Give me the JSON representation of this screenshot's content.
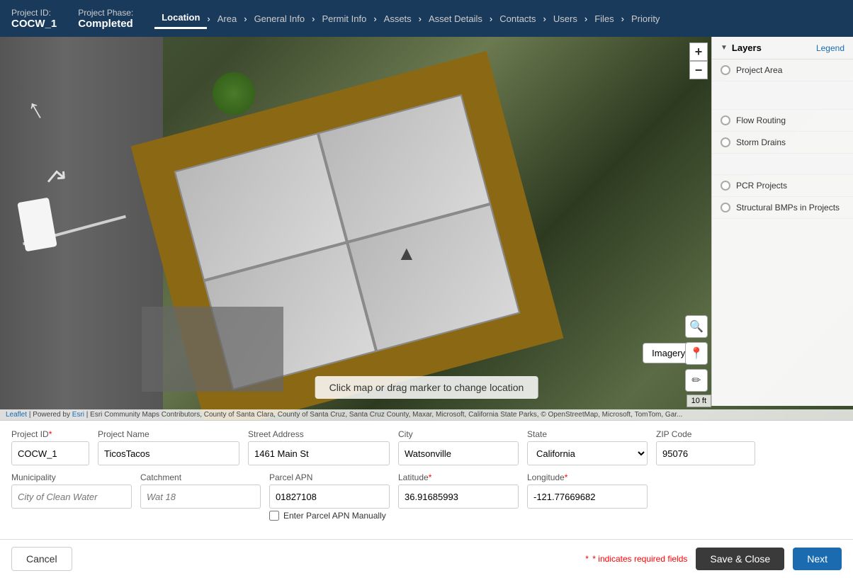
{
  "header": {
    "project_id_label": "Project ID:",
    "project_id_value": "COCW_1",
    "phase_label": "Project Phase:",
    "phase_value": "Completed"
  },
  "nav": {
    "tabs": [
      {
        "id": "location",
        "label": "Location",
        "active": true
      },
      {
        "id": "area",
        "label": "Area"
      },
      {
        "id": "general-info",
        "label": "General Info"
      },
      {
        "id": "permit-info",
        "label": "Permit Info"
      },
      {
        "id": "assets",
        "label": "Assets"
      },
      {
        "id": "asset-details",
        "label": "Asset Details"
      },
      {
        "id": "contacts",
        "label": "Contacts"
      },
      {
        "id": "users",
        "label": "Users"
      },
      {
        "id": "files",
        "label": "Files"
      },
      {
        "id": "priority",
        "label": "Priority"
      }
    ]
  },
  "layers": {
    "title": "Layers",
    "legend_link": "Legend",
    "items": [
      {
        "id": "project-area",
        "label": "Project Area"
      },
      {
        "id": "flow-routing",
        "label": "Flow Routing"
      },
      {
        "id": "storm-drains",
        "label": "Storm Drains"
      },
      {
        "id": "pcr-projects",
        "label": "PCR Projects"
      },
      {
        "id": "structural-bmps",
        "label": "Structural BMPs in Projects"
      }
    ]
  },
  "map": {
    "instruction": "Click map or drag marker to change location",
    "attribution": "Leaflet | Powered by Esri | Esri Community Maps Contributors, County of Santa Clara, County of Santa Cruz, Santa Cruz County, Maxar, Microsoft, California State Parks, © OpenStreetMap, Microsoft, TomTom, Gar...",
    "scale": "10 ft",
    "imagery_label": "Imagery"
  },
  "form": {
    "project_id_label": "Project ID",
    "project_id_value": "COCW_1",
    "project_name_label": "Project Name",
    "project_name_value": "TicosTacos",
    "street_label": "Street Address",
    "street_value": "1461 Main St",
    "city_label": "City",
    "city_value": "Watsonville",
    "state_label": "State",
    "state_value": "California",
    "zip_label": "ZIP Code",
    "zip_value": "95076",
    "municipality_label": "Municipality",
    "municipality_placeholder": "City of Clean Water",
    "catchment_label": "Catchment",
    "catchment_placeholder": "Wat 18",
    "parcel_label": "Parcel APN",
    "parcel_value": "01827108",
    "lat_label": "Latitude",
    "lat_value": "36.91685993",
    "lon_label": "Longitude",
    "lon_value": "-121.77669682",
    "parcel_checkbox_label": "Enter Parcel APN Manually"
  },
  "footer": {
    "cancel_label": "Cancel",
    "save_label": "Save & Close",
    "next_label": "Next",
    "required_note": "* indicates required fields"
  }
}
